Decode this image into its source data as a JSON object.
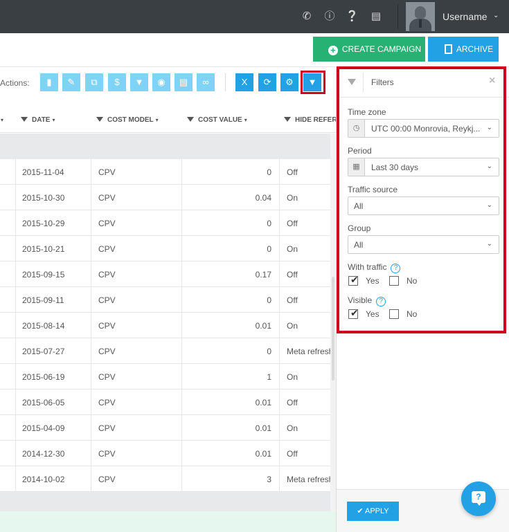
{
  "topbar": {
    "icons": [
      "phone-icon",
      "info-icon",
      "help-icon",
      "news-icon"
    ],
    "username": "Username"
  },
  "toolbar": {
    "create_label": "CREATE CAMPAIGN",
    "archive_label": "ARCHIVE",
    "actions_label": "Actions:"
  },
  "columns": [
    {
      "label": "DATE"
    },
    {
      "label": "COST MODEL"
    },
    {
      "label": "COST VALUE"
    },
    {
      "label": "HIDE REFER"
    }
  ],
  "rows": [
    {
      "date": "2015-11-04",
      "model": "CPV",
      "value": "0",
      "hide": "Off"
    },
    {
      "date": "2015-10-30",
      "model": "CPV",
      "value": "0.04",
      "hide": "On"
    },
    {
      "date": "2015-10-29",
      "model": "CPV",
      "value": "0",
      "hide": "Off"
    },
    {
      "date": "2015-10-21",
      "model": "CPV",
      "value": "0",
      "hide": "On"
    },
    {
      "date": "2015-09-15",
      "model": "CPV",
      "value": "0.17",
      "hide": "Off"
    },
    {
      "date": "2015-09-11",
      "model": "CPV",
      "value": "0",
      "hide": "Off"
    },
    {
      "date": "2015-08-14",
      "model": "CPV",
      "value": "0.01",
      "hide": "On"
    },
    {
      "date": "2015-07-27",
      "model": "CPV",
      "value": "0",
      "hide": "Meta refresh"
    },
    {
      "date": "2015-06-19",
      "model": "CPV",
      "value": "1",
      "hide": "On"
    },
    {
      "date": "2015-06-05",
      "model": "CPV",
      "value": "0.01",
      "hide": "Off"
    },
    {
      "date": "2015-04-09",
      "model": "CPV",
      "value": "0.01",
      "hide": "On"
    },
    {
      "date": "2014-12-30",
      "model": "CPV",
      "value": "0.01",
      "hide": "Off"
    },
    {
      "date": "2014-10-02",
      "model": "CPV",
      "value": "3",
      "hide": "Meta refresh"
    }
  ],
  "filters": {
    "title": "Filters",
    "close": "×",
    "timezone_label": "Time zone",
    "timezone_value": "UTC 00:00 Monrovia, Reykj...",
    "period_label": "Period",
    "period_value": "Last 30 days",
    "source_label": "Traffic source",
    "source_value": "All",
    "group_label": "Group",
    "group_value": "All",
    "with_traffic_label": "With traffic",
    "visible_label": "Visible",
    "yes": "Yes",
    "no": "No",
    "help": "?",
    "apply": "APPLY"
  },
  "fab": {
    "label": "?"
  },
  "colors": {
    "green": "#27b274",
    "blue": "#22a1e4",
    "light_blue": "#7fd3f4",
    "highlight": "#d0021b",
    "topbar": "#3a3f44"
  }
}
